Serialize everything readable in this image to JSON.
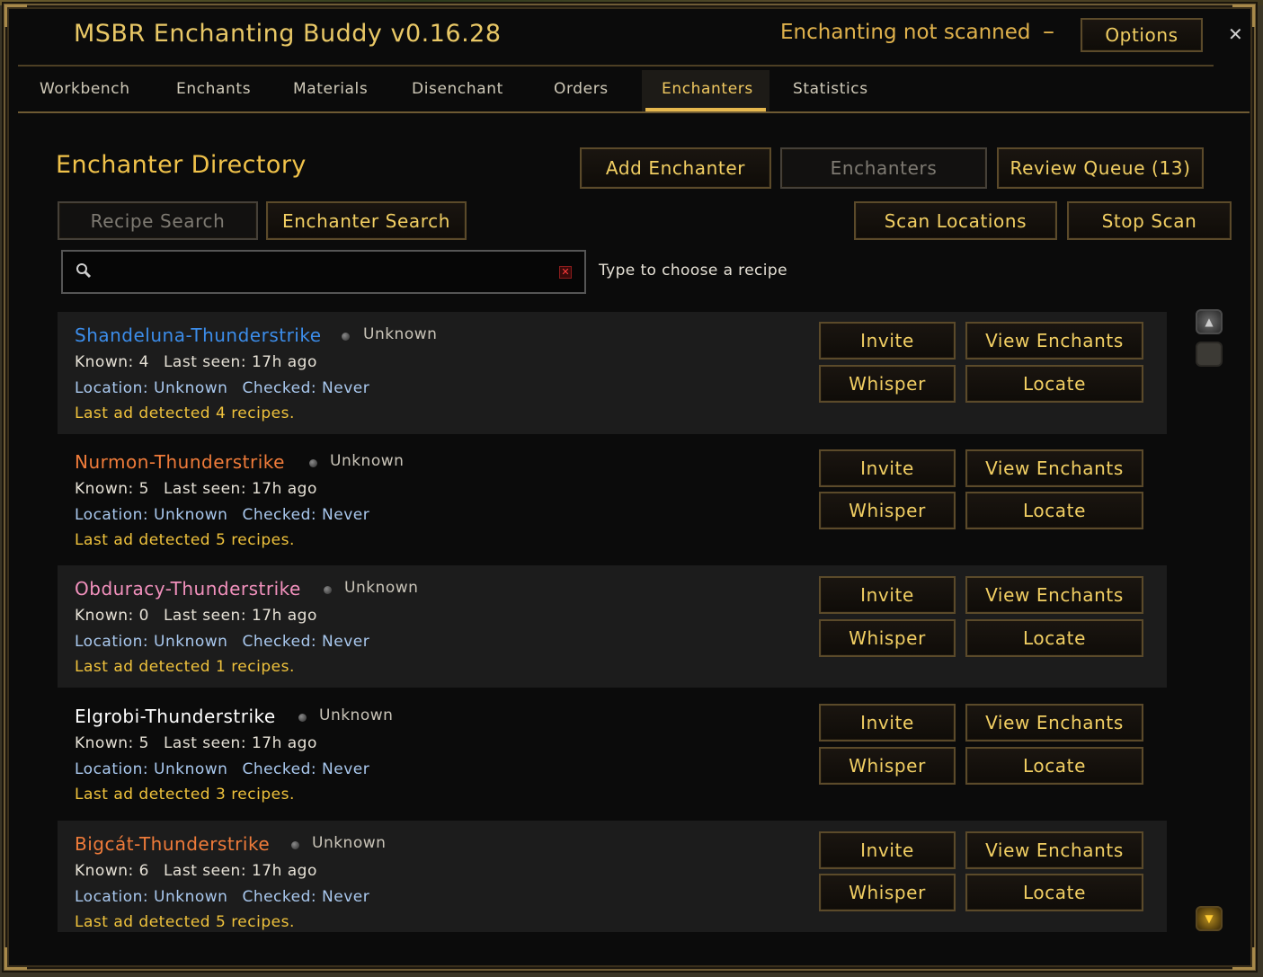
{
  "window": {
    "title": "MSBR Enchanting Buddy v0.16.28",
    "status": "Enchanting not scanned",
    "minimize_label": "–",
    "options_label": "Options",
    "close_label": "✕"
  },
  "tabs": [
    {
      "label": "Workbench"
    },
    {
      "label": "Enchants"
    },
    {
      "label": "Materials"
    },
    {
      "label": "Disenchant"
    },
    {
      "label": "Orders"
    },
    {
      "label": "Enchanters",
      "active": true
    },
    {
      "label": "Statistics"
    }
  ],
  "directory": {
    "title": "Enchanter Directory",
    "add_label": "Add Enchanter",
    "enchanters_label": "Enchanters",
    "review_label": "Review Queue (13)",
    "recipe_search_label": "Recipe Search",
    "enchanter_search_label": "Enchanter Search",
    "scan_locations_label": "Scan Locations",
    "stop_scan_label": "Stop Scan",
    "search_value": "",
    "search_placeholder": "",
    "hint": "Type to choose a recipe"
  },
  "card_labels": {
    "invite": "Invite",
    "view_enchants": "View Enchants",
    "whisper": "Whisper",
    "locate": "Locate"
  },
  "enchanters": [
    {
      "name": "Shandeluna-Thunderstrike",
      "color": "#3c8dea",
      "presence": "Unknown",
      "known": "Known: 4",
      "last_seen": "Last seen: 17h ago",
      "location": "Location: Unknown",
      "checked": "Checked: Never",
      "ad": "Last ad detected 4 recipes."
    },
    {
      "name": "Nurmon-Thunderstrike",
      "color": "#ef7b3a",
      "presence": "Unknown",
      "known": "Known: 5",
      "last_seen": "Last seen: 17h ago",
      "location": "Location: Unknown",
      "checked": "Checked: Never",
      "ad": "Last ad detected 5 recipes."
    },
    {
      "name": "Obduracy-Thunderstrike",
      "color": "#f291bd",
      "presence": "Unknown",
      "known": "Known: 0",
      "last_seen": "Last seen: 17h ago",
      "location": "Location: Unknown",
      "checked": "Checked: Never",
      "ad": "Last ad detected 1 recipes."
    },
    {
      "name": "Elgrobi-Thunderstrike",
      "color": "#ffffff",
      "presence": "Unknown",
      "known": "Known: 5",
      "last_seen": "Last seen: 17h ago",
      "location": "Location: Unknown",
      "checked": "Checked: Never",
      "ad": "Last ad detected 3 recipes."
    },
    {
      "name": "Bigcát-Thunderstrike",
      "color": "#ef7b3a",
      "presence": "Unknown",
      "known": "Known: 6",
      "last_seen": "Last seen: 17h ago",
      "location": "Location: Unknown",
      "checked": "Checked: Never",
      "ad": "Last ad detected 5 recipes."
    }
  ],
  "icons": {
    "search": "magnifier-icon",
    "clear": "clear-x-icon",
    "presence": "status-dot-icon",
    "scroll_up": "scroll-up-icon",
    "scroll_thumb": "scroll-thumb-icon",
    "scroll_bottom": "scroll-bottom-icon"
  },
  "colors": {
    "accent_gold": "#f0c24a",
    "location_blue": "#a9c8ee",
    "ad_yellow": "#efc23c"
  }
}
